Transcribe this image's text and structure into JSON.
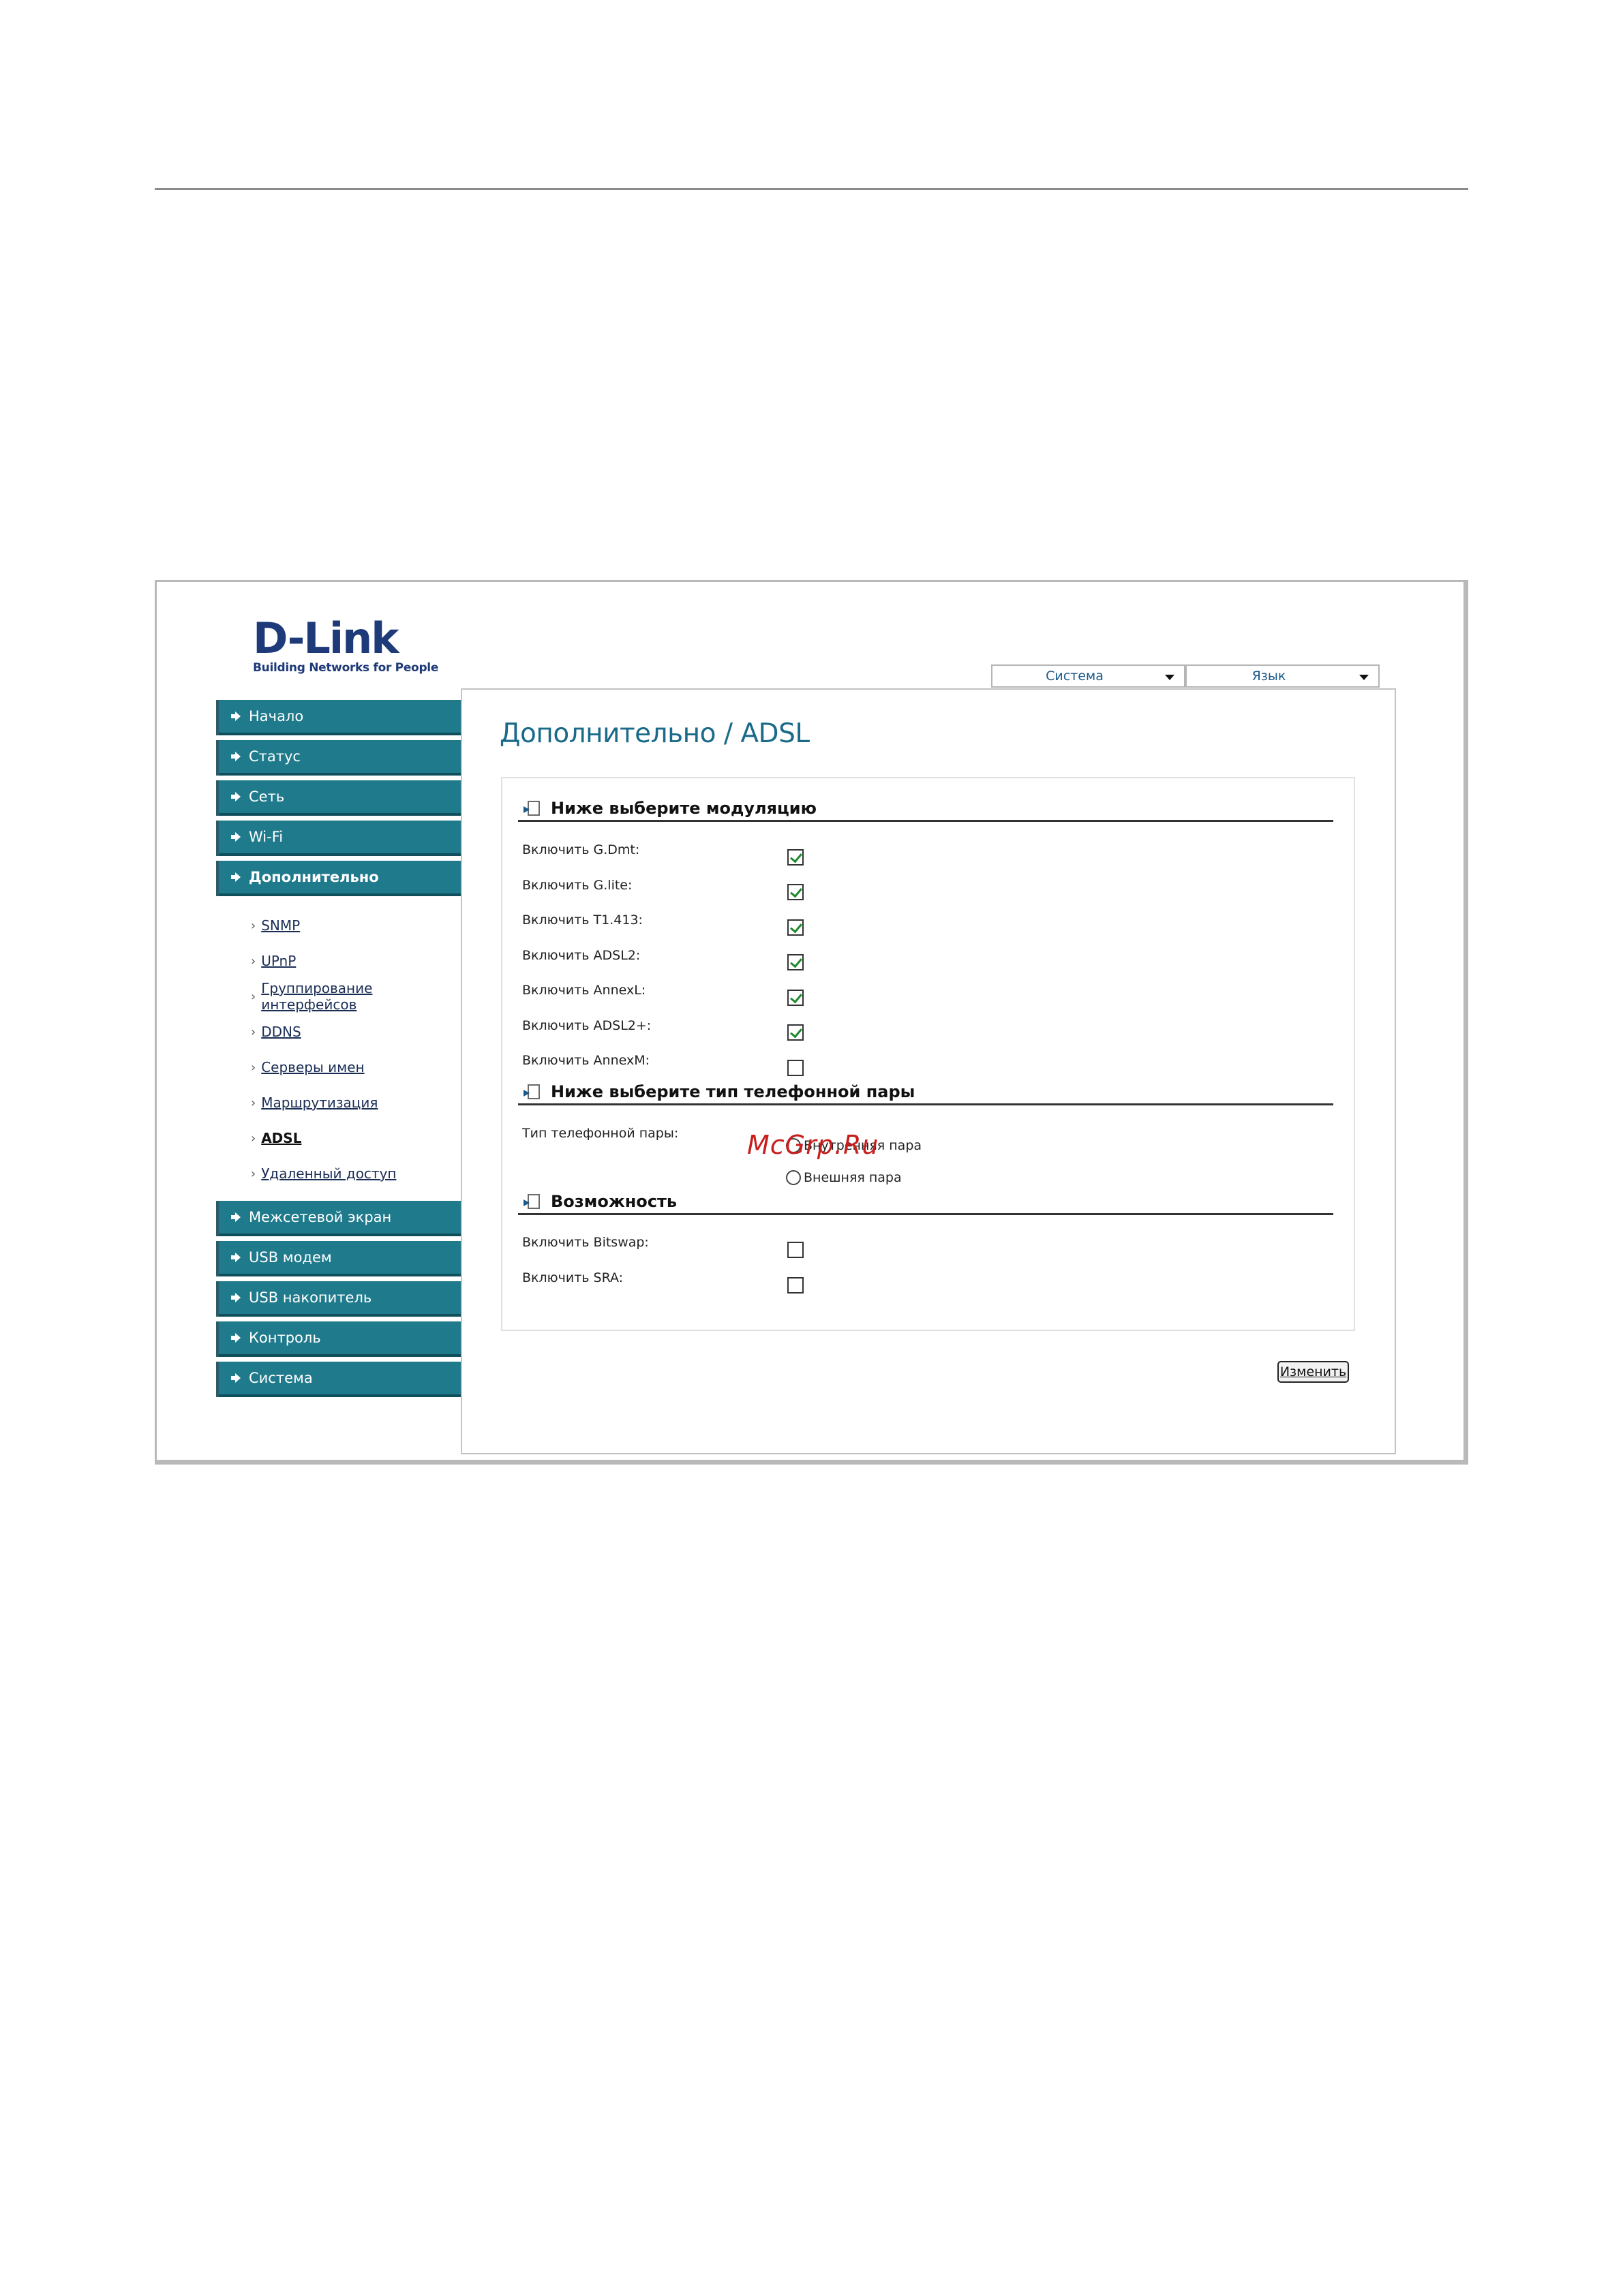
{
  "brand": {
    "name": "D-Link",
    "tagline": "Building Networks for People"
  },
  "top_menus": [
    {
      "label": "Система"
    },
    {
      "label": "Язык"
    }
  ],
  "sidebar": {
    "items": [
      {
        "label": "Начало"
      },
      {
        "label": "Статус"
      },
      {
        "label": "Сеть"
      },
      {
        "label": "Wi-Fi"
      },
      {
        "label": "Дополнительно",
        "active": true
      },
      {
        "label": "Межсетевой экран"
      },
      {
        "label": "USB модем"
      },
      {
        "label": "USB накопитель"
      },
      {
        "label": "Контроль"
      },
      {
        "label": "Система"
      }
    ],
    "subitems": [
      {
        "label": "SNMP"
      },
      {
        "label": "UPnP"
      },
      {
        "label": "Группирование интерфейсов"
      },
      {
        "label": "DDNS"
      },
      {
        "label": "Серверы имен"
      },
      {
        "label": "Маршрутизация"
      },
      {
        "label": "ADSL",
        "current": true
      },
      {
        "label": "Удаленный доступ"
      }
    ]
  },
  "page": {
    "title": "Дополнительно / ADSL"
  },
  "sections": {
    "modulation": {
      "title": "Ниже выберите модуляцию",
      "options": [
        {
          "label": "Включить G.Dmt:",
          "checked": true
        },
        {
          "label": "Включить G.lite:",
          "checked": true
        },
        {
          "label": "Включить T1.413:",
          "checked": true
        },
        {
          "label": "Включить ADSL2:",
          "checked": true
        },
        {
          "label": "Включить AnnexL:",
          "checked": true
        },
        {
          "label": "Включить ADSL2+:",
          "checked": true
        },
        {
          "label": "Включить AnnexM:",
          "checked": false
        }
      ]
    },
    "pair": {
      "title": "Ниже выберите тип телефонной пары",
      "label": "Тип телефонной пары:",
      "options": [
        {
          "label": "Внутренняя пара",
          "selected": false
        },
        {
          "label": "Внешняя пара",
          "selected": false
        }
      ]
    },
    "features": {
      "title": "Возможность",
      "options": [
        {
          "label": "Включить Bitswap:",
          "checked": false
        },
        {
          "label": "Включить SRA:",
          "checked": false
        }
      ]
    }
  },
  "actions": {
    "submit_label": "Изменить"
  },
  "watermark": "McGrp.Ru",
  "colors": {
    "nav_bg": "#1f7a8c",
    "title": "#1a6a8a",
    "brand": "#1e3a78",
    "check": "#1e8a2e"
  }
}
